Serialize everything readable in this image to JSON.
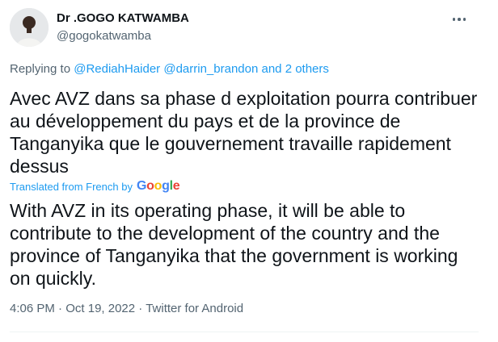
{
  "author": {
    "name": "Dr .GOGO KATWAMBA",
    "handle": "@gogokatwamba",
    "avatar_icon": "profile-photo"
  },
  "more_icon": "more-options-icon",
  "reply": {
    "prefix": "Replying to",
    "mention1": "@RediahHaider",
    "mention2": "@darrin_brandon",
    "joiner": "and",
    "others": "2 others"
  },
  "tweet": {
    "original_text": "Avec AVZ dans sa phase d exploitation pourra contribuer au développement du pays et de la province de Tanganyika que le gouvernement travaille rapidement dessus",
    "translated_label": "Translated from French by",
    "translation_provider": "Google",
    "translation_text": "With AVZ in its operating phase, it will be able to contribute to the development of the country and the province of Tanganyika that the government is working on quickly."
  },
  "meta": {
    "time": "4:06 PM",
    "separator": "·",
    "date": "Oct 19, 2022",
    "source": "Twitter for Android"
  },
  "colors": {
    "accent": "#1d9bf0",
    "text": "#0f1419",
    "secondary": "#536471"
  }
}
